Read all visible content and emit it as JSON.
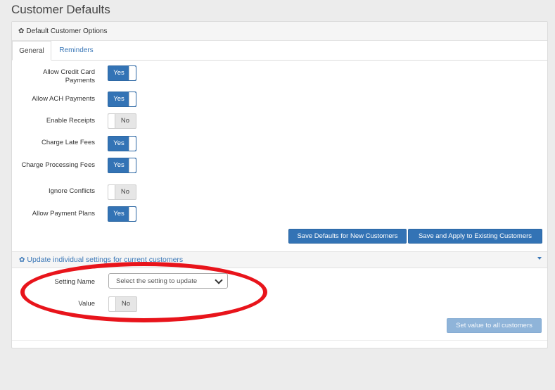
{
  "page": {
    "title": "Customer Defaults"
  },
  "panel": {
    "heading": "Default Customer Options",
    "tabs": [
      {
        "label": "General"
      },
      {
        "label": "Reminders"
      }
    ]
  },
  "settings": [
    {
      "label": "Allow Credit Card Payments",
      "value": "Yes"
    },
    {
      "label": "Allow ACH Payments",
      "value": "Yes"
    },
    {
      "label": "Enable Receipts",
      "value": "No"
    },
    {
      "label": "Charge Late Fees",
      "value": "Yes"
    },
    {
      "label": "Charge Processing Fees",
      "value": "Yes"
    },
    {
      "label": "Ignore Conflicts",
      "value": "No"
    },
    {
      "label": "Allow Payment Plans",
      "value": "Yes"
    }
  ],
  "buttons": {
    "save_defaults": "Save Defaults for New Customers",
    "save_apply": "Save and Apply to Existing Customers",
    "set_value_all": "Set value to all customers"
  },
  "update_section": {
    "heading": "Update individual settings for current customers",
    "setting_name_label": "Setting Name",
    "setting_select_value": "Select the setting to update",
    "value_label": "Value",
    "value_toggle": "No"
  },
  "colors": {
    "accent": "#3373b5",
    "annotation": "#e8141b"
  }
}
